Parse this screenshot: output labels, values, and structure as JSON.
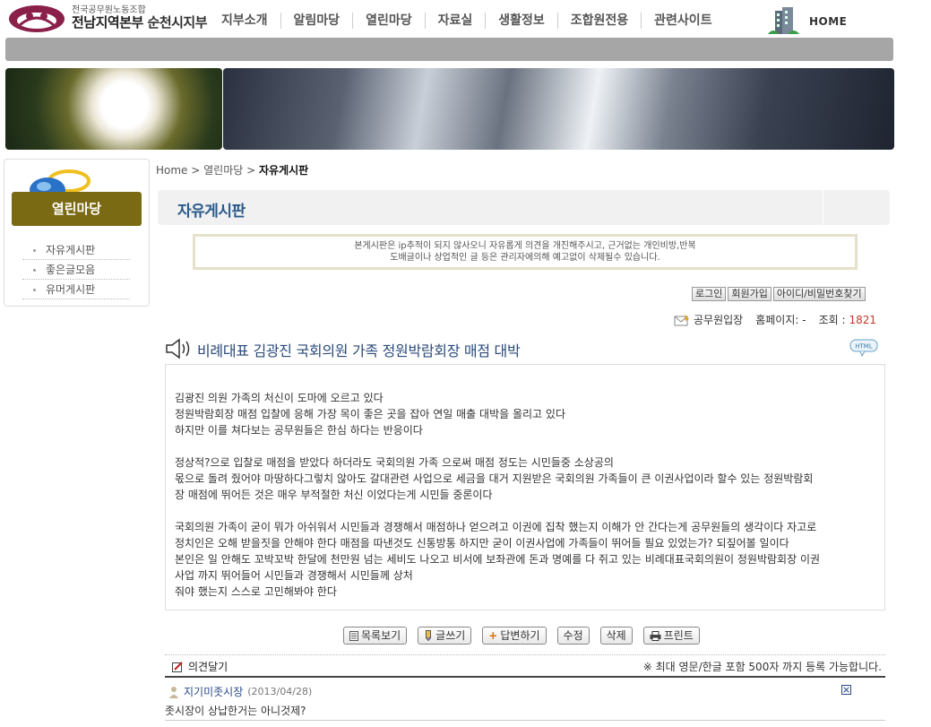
{
  "header": {
    "org_top": "전국공무원노동조합",
    "org_main_prefix": "전남지역본부 ",
    "org_main_accent": "순천시지부",
    "nav": [
      "지부소개",
      "알림마당",
      "열린마당",
      "자료실",
      "생활정보",
      "조합원전용",
      "관련사이트"
    ],
    "home_label": "HOME"
  },
  "sidebar": {
    "title": "열린마당",
    "items": [
      "자유게시판",
      "좋은글모음",
      "유머게시판"
    ]
  },
  "breadcrumb": {
    "home": "Home",
    "sep": " > ",
    "section": "열린마당",
    "current": "자유게시판"
  },
  "board": {
    "title": "자유게시판",
    "notice_line1": "본게시판은 ip추적이 되지 않사오니 자유롭게 의견을 개진해주시고, 근거없는 개인비방,반복",
    "notice_line2": "도배글이나 상업적인 글 등은 관리자에의해 예고없이 삭제될수 있습니다."
  },
  "member_buttons": [
    "로그인",
    "회원가입",
    "아이디/비밀번호찾기"
  ],
  "post": {
    "author": "공무원입장",
    "homepage_label": "홈페이지: -",
    "hits_label": "조회 : ",
    "hits": "1821",
    "title": "비례대표 김광진 국회의원 가족 정원박람회장 매점 대박",
    "body": [
      [
        "김광진 의원 가족의 처신이 도마에 오르고 있다",
        "정원박람회장 매점 입찰에 응해 가장 목이 좋은 곳을 잡아 연일 매출 대박을 올리고 있다",
        "하지만 이를 쳐다보는 공무원들은 한심 하다는 반응이다"
      ],
      [
        "정상적?으로 입찰로 매점을 받았다 하더라도 국회의원 가족 으로써 매점 정도는 시민들중 소상공의",
        "몫으로 돌려 줬어야 마땅하다그렇치 않아도 갈대관련 사업으로 세금을 대거 지원받은 국회의원 가족들이 큰 이권사업이라 할수 있는 정원박람회",
        "장 매점에 뛰어든 것은 매우 부적절한 처신 이었다는게 시민들 중론이다"
      ],
      [
        "국회의원 가족이 굳이 뭐가 아쉬워서 시민들과 경쟁해서 매점하나 얻으려고 이권에 집착 했는지 이해가 안 간다는게 공무원들의 생각이다 자고로",
        "정치인은 오해 받을짓을 안해야 한다 매점을 따낸것도 신통방통 하지만 굳이 이권사업에 가족들이 뛰어들 필요 있었는가? 되짚어볼 일이다",
        "본인은 일 안해도 꼬박꼬박 한달에 천만원 넘는 세비도 나오고 비서에 보좌관에 돈과 명예를 다 쥐고 있는 비례대표국회의원이 정원박람회장 이권",
        "사업 까지 뛰어들어 시민들과 경쟁해서 시민들께 상처",
        "줘야 했는지 스스로 고민해봐야 한다"
      ]
    ]
  },
  "actions": [
    "목록보기",
    "글쓰기",
    "답변하기",
    "수정",
    "삭제",
    "프린트"
  ],
  "comments": {
    "header": "의견달기",
    "note": "※ 최대 영문/한글 포함 500자 까지 등록 가능합니다.",
    "items": [
      {
        "author": "지기미좃시장",
        "date": "(2013/04/28)",
        "text": "좃시장이 상납한거는 아니것제?"
      }
    ]
  },
  "icons": {
    "logo": "union-logo-icon",
    "home": "building-icon",
    "speaker": "speaker-icon",
    "html": "html-speech-icon",
    "author": "letter-icon",
    "comment_header": "memo-pencil-icon",
    "comment_author": "person-icon",
    "comment_delete": "close-box-icon"
  }
}
